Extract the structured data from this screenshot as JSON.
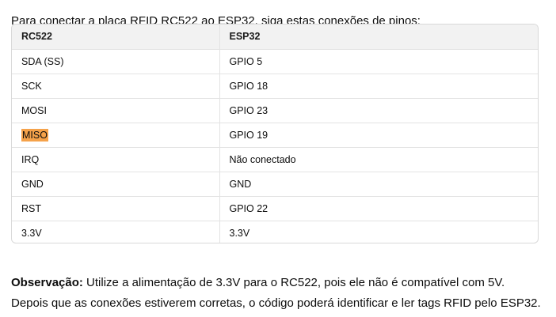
{
  "intro": "Para conectar a placa RFID RC522 ao ESP32, siga estas conexões de pinos:",
  "table": {
    "headers": [
      "RC522",
      "ESP32"
    ],
    "rows": [
      [
        "SDA (SS)",
        "GPIO 5"
      ],
      [
        "SCK",
        "GPIO 18"
      ],
      [
        "MOSI",
        "GPIO 23"
      ],
      [
        "MISO",
        "GPIO 19"
      ],
      [
        "IRQ",
        "Não conectado"
      ],
      [
        "GND",
        "GND"
      ],
      [
        "RST",
        "GPIO 22"
      ],
      [
        "3.3V",
        "3.3V"
      ]
    ],
    "highlight_color": "#f5a24a"
  },
  "note": {
    "label": "Observação:",
    "text": " Utilize a alimentação de 3.3V para o RC522, pois ele não é compatível com 5V. Depois que as conexões estiverem corretas, o código poderá identificar e ler tags RFID pelo ESP32."
  }
}
